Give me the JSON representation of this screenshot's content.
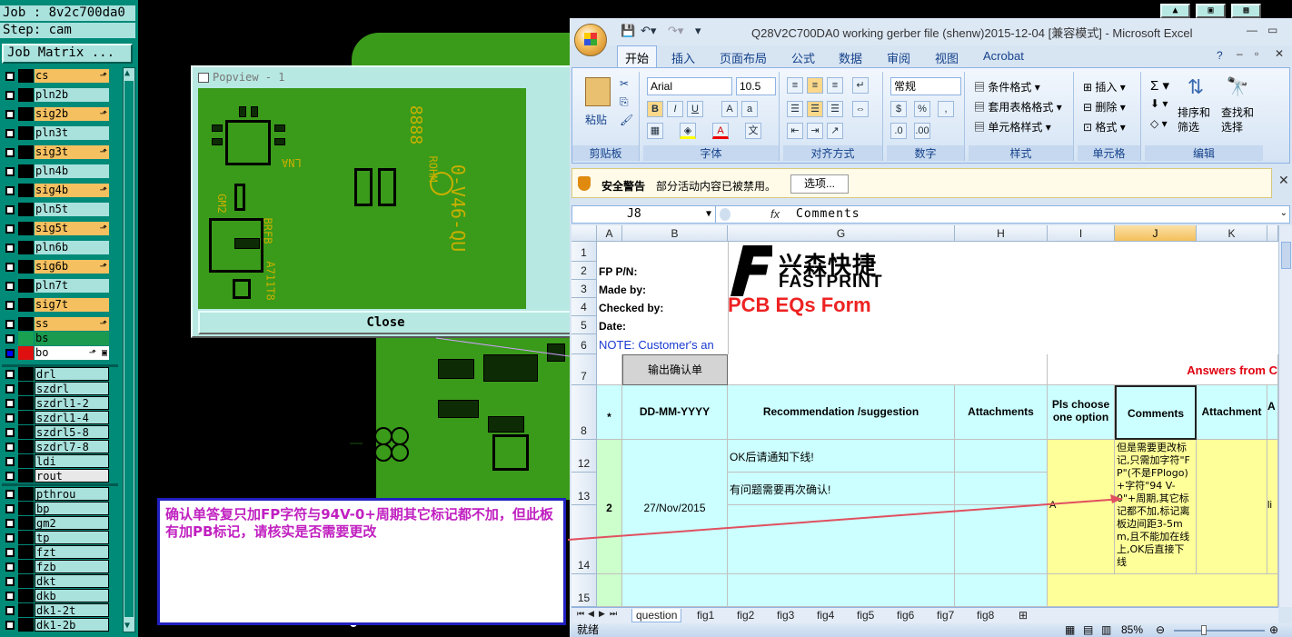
{
  "genesis": {
    "job": "Job : 8v2c700da0",
    "step": "Step: cam",
    "job_matrix": "Job Matrix ...",
    "layers": [
      {
        "name": "cs",
        "color": "#f5c060",
        "flag": "⬏"
      },
      {
        "name": "pln2b",
        "color": "#a9e2dd",
        "flag": ""
      },
      {
        "name": "sig2b",
        "color": "#f5c060",
        "flag": "⬏"
      },
      {
        "name": "pln3t",
        "color": "#a9e2dd",
        "flag": ""
      },
      {
        "name": "sig3t",
        "color": "#f5c060",
        "flag": "⬏"
      },
      {
        "name": "pln4b",
        "color": "#a9e2dd",
        "flag": ""
      },
      {
        "name": "sig4b",
        "color": "#f5c060",
        "flag": "⬏"
      },
      {
        "name": "pln5t",
        "color": "#a9e2dd",
        "flag": ""
      },
      {
        "name": "sig5t",
        "color": "#f5c060",
        "flag": "⬏"
      },
      {
        "name": "pln6b",
        "color": "#a9e2dd",
        "flag": ""
      },
      {
        "name": "sig6b",
        "color": "#f5c060",
        "flag": "⬏"
      },
      {
        "name": "pln7t",
        "color": "#a9e2dd",
        "flag": ""
      },
      {
        "name": "sig7t",
        "color": "#f5c060",
        "flag": ""
      },
      {
        "name": "ss",
        "color": "#f5c060",
        "flag": "⬏"
      },
      {
        "name": "bs",
        "color": "#1a9a50",
        "flag": ""
      },
      {
        "name": "bo",
        "color": "#ffffff",
        "flag": "⬏ ▣"
      }
    ],
    "layers2": [
      "drl",
      "szdrl",
      "szdrl1-2",
      "szdrl1-4",
      "szdrl5-8",
      "szdrl7-8",
      "ldi",
      "rout"
    ],
    "layers3": [
      "pthrou",
      "bp",
      "gm2",
      "tp",
      "fzt",
      "fzb",
      "dkt",
      "dkb",
      "dk1-2t",
      "dk1-2b"
    ],
    "popview_title": "Popview - 1",
    "close": "Close",
    "pcb_text": [
      "0-V46-QU",
      "8888",
      "BRFB",
      "A711T8",
      "ROHM",
      "LNA",
      "GM2"
    ],
    "note": "确认单答复只加FP字符与94V-0+周期其它标记都不加，但此板有加PB标记，请核实是否需要更改"
  },
  "excel": {
    "title": "Q28V2C700DA0 working gerber file (shenw)2015-12-04  [兼容模式] - Microsoft Excel",
    "tabs": [
      "开始",
      "插入",
      "页面布局",
      "公式",
      "数据",
      "审阅",
      "视图",
      "Acrobat"
    ],
    "ribbon": {
      "paste": "粘贴",
      "clipboard": "剪贴板",
      "font_name": "Arial",
      "font_size": "10.5",
      "font": "字体",
      "align": "对齐方式",
      "number_format": "常规",
      "number": "数字",
      "cond_format": "条件格式",
      "table_format": "套用表格格式",
      "cell_style": "单元格样式",
      "styles": "样式",
      "insert": "插入",
      "delete": "删除",
      "format": "格式",
      "cells": "单元格",
      "sort": "排序和",
      "filter": "筛选",
      "find": "查找和",
      "select": "选择",
      "editing": "编辑"
    },
    "security": {
      "title": "安全警告",
      "text": "部分活动内容已被禁用。",
      "button": "选项..."
    },
    "namebox": "J8",
    "formula": "Comments",
    "columns": [
      "A",
      "B",
      "G",
      "H",
      "I",
      "J",
      "K"
    ],
    "rows": [
      "1",
      "2",
      "3",
      "4",
      "5",
      "6",
      "7",
      "8",
      "12",
      "13",
      "14",
      "15"
    ],
    "labels": {
      "fp": "FP P/N:",
      "made": "Made by:",
      "checked": "Checked by:",
      "date": "Date:",
      "note": "NOTE: Customer's  an",
      "output": "输出确认单",
      "answers": "Answers from C",
      "star": "*",
      "ddmm": "DD-MM-YYYY",
      "rec": "Recommendation /suggestion",
      "att": "Attachments",
      "pls": "Pls choose one option",
      "comments": "Comments",
      "attach": "Attachment",
      "a_col": "A",
      "num": "2",
      "date_val": "27/Nov/2015",
      "rec1": "OK后请通知下线!",
      "rec2": "有问题需要再次确认!",
      "opt": "A",
      "li": "li",
      "comment_val": "但是需要更改标记,只需加字符\"FP\"(不是FPlogo)+字符\"94 V-0\"+周期,其它标记都不加,标记离板边间距3-5mm,且不能加在线上,OK后直接下线"
    },
    "logo_cn": "兴森快捷",
    "logo_en": "FASTPRINT",
    "form_title": "PCB EQs Form",
    "sheets": [
      "question",
      "fig1",
      "fig2",
      "fig3",
      "fig4",
      "fig5",
      "fig6",
      "fig7",
      "fig8"
    ],
    "status": "就绪",
    "zoom": "85%"
  }
}
